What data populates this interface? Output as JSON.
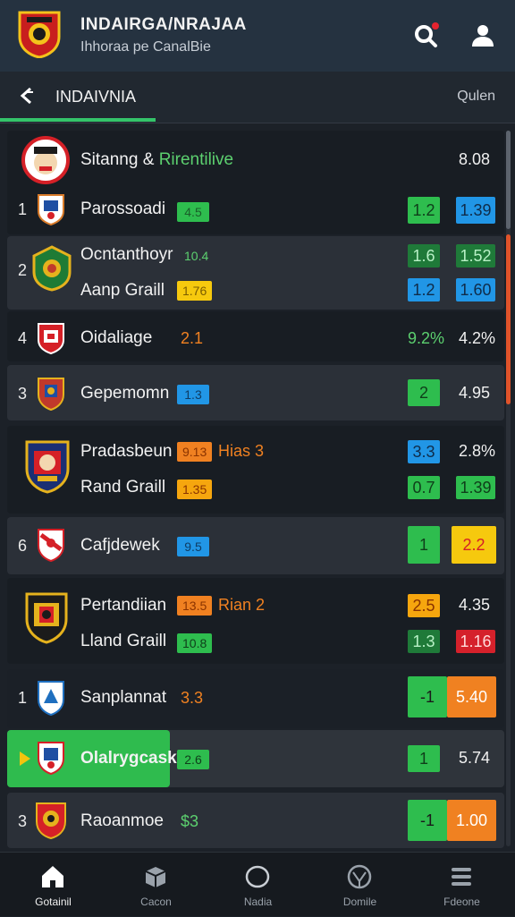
{
  "header": {
    "title": "INDAIRGA/NRAJAA",
    "subtitle": "Ihhoraa pe CanalBie"
  },
  "tabbar": {
    "title": "INDAIVNIA",
    "right_label": "Qulen"
  },
  "league": {
    "name": "Sitanng &",
    "name_accent": "Rirentilive",
    "value": "8.08"
  },
  "rows": [
    {
      "rank": "1",
      "team": "Parossoadi",
      "badge": "4.5",
      "c1": "1.2",
      "c2": "1.39"
    },
    {
      "rank": "2",
      "team": "Ocntanthoyr",
      "badge": "10.4",
      "team2": "Aanp Graill",
      "badge2": "1.76",
      "c1": "1.6",
      "c2": "1.52",
      "c3": "1.2",
      "c4": "1.60"
    },
    {
      "rank": "4",
      "team": "Oidaliage",
      "extra": "2.1",
      "c1": "9.2%",
      "c2": "4.2%"
    },
    {
      "rank": "3",
      "team": "Gepemomn",
      "badge": "1.3",
      "c1": "2",
      "c2": "4.95"
    },
    {
      "rank": "",
      "team": "Pradasbeun",
      "badge": "9.13",
      "extra": "Hias 3",
      "team2": "Rand Graill",
      "badge2": "1.35",
      "c1": "3.3",
      "c2": "2.8%",
      "c3": "0.7",
      "c4": "1.39"
    },
    {
      "rank": "6",
      "team": "Cafjdewek",
      "badge": "9.5",
      "c1": "1",
      "c2": "2.2"
    },
    {
      "rank": "",
      "team": "Pertandiian",
      "badge": "13.5",
      "extra": "Rian 2",
      "team2": "Lland Graill",
      "badge2": "10.8",
      "c1": "2.5",
      "c2": "4.35",
      "c3": "1.3",
      "c4": "1.16"
    },
    {
      "rank": "1",
      "team": "Sanplannat",
      "extra": "3.3",
      "c1": "-1",
      "c2": "5.40"
    },
    {
      "rank": "",
      "team": "Olalrygcask",
      "badge": "2.6",
      "c1": "1",
      "c2": "5.74"
    },
    {
      "rank": "3",
      "team": "Raoanmoe",
      "extra": "$3",
      "c1": "-1",
      "c2": "1.00"
    }
  ],
  "nav": [
    {
      "label": "Gotainil",
      "icon": "home-icon"
    },
    {
      "label": "Cacon",
      "icon": "box-icon"
    },
    {
      "label": "Nadia",
      "icon": "circle-icon"
    },
    {
      "label": "Domile",
      "icon": "ball-icon"
    },
    {
      "label": "Fdeone",
      "icon": "menu-icon"
    }
  ],
  "colors": {
    "accent": "#34c46a",
    "header": "#253240",
    "background": "#1c2128",
    "highlight": "#2fbb4e",
    "orange": "#f08121"
  }
}
